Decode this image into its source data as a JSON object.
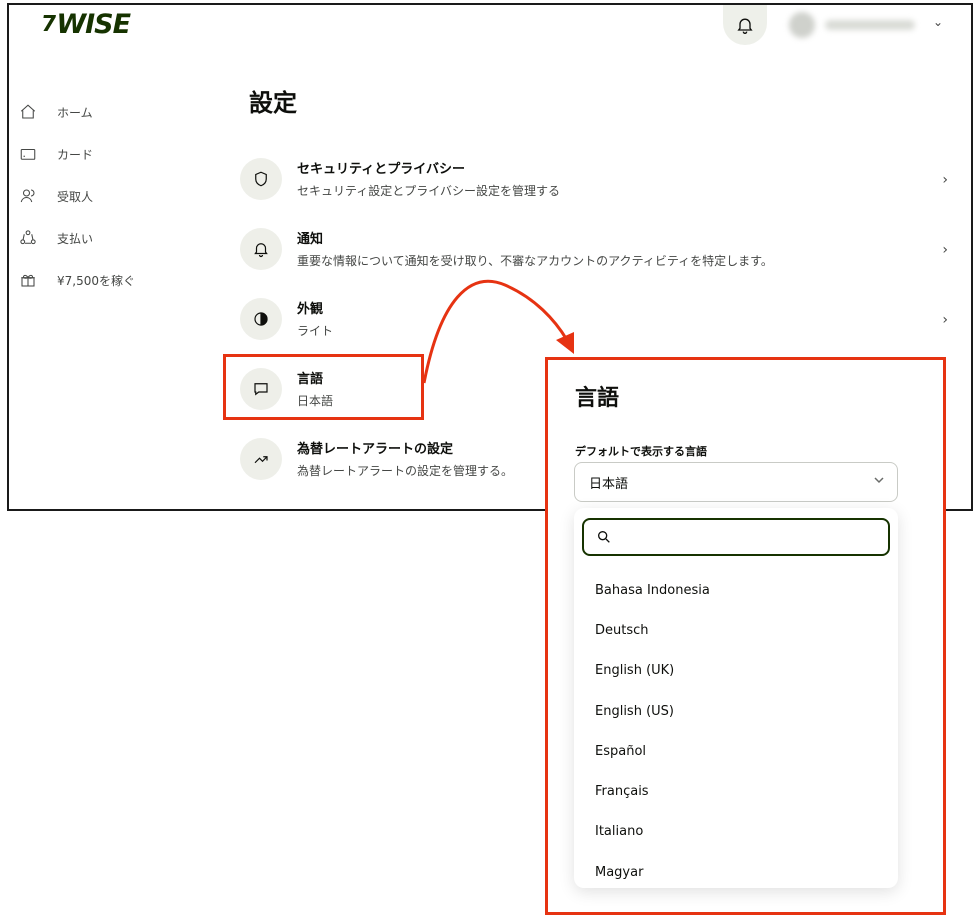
{
  "header": {
    "logo_mark": "7",
    "logo_text": "WISE",
    "icons": [
      "bell-icon",
      "chevron-down-icon"
    ]
  },
  "sidebar": {
    "items": [
      {
        "label": "ホーム",
        "icon": "home-icon"
      },
      {
        "label": "カード",
        "icon": "card-icon"
      },
      {
        "label": "受取人",
        "icon": "recipients-icon"
      },
      {
        "label": "支払い",
        "icon": "payments-icon"
      },
      {
        "label": "¥7,500を稼ぐ",
        "icon": "gift-icon"
      }
    ]
  },
  "main": {
    "title": "設定",
    "settings": [
      {
        "title": "セキュリティとプライバシー",
        "subtitle": "セキュリティ設定とプライバシー設定を管理する",
        "icon": "shield-icon",
        "chevron": "›"
      },
      {
        "title": "通知",
        "subtitle": "重要な情報について通知を受け取り、不審なアカウントのアクティビティを特定します。",
        "icon": "bell-icon",
        "chevron": "›"
      },
      {
        "title": "外観",
        "subtitle": "ライト",
        "icon": "contrast-icon",
        "chevron": "›"
      },
      {
        "title": "言語",
        "subtitle": "日本語",
        "icon": "chat-icon"
      },
      {
        "title": "為替レートアラートの設定",
        "subtitle": "為替レートアラートの設定を管理する。",
        "icon": "trend-icon"
      }
    ]
  },
  "language_panel": {
    "title": "言語",
    "field_label": "デフォルトで表示する言語",
    "selected": "日本語",
    "search_placeholder": "",
    "options": [
      "Bahasa Indonesia",
      "Deutsch",
      "English (UK)",
      "English (US)",
      "Español",
      "Français",
      "Italiano",
      "Magyar"
    ]
  },
  "colors": {
    "brand": "#163300",
    "highlight": "#e63312",
    "icon_bg": "#eeefe9",
    "text": "#0e0f0c",
    "muted": "#454745"
  }
}
